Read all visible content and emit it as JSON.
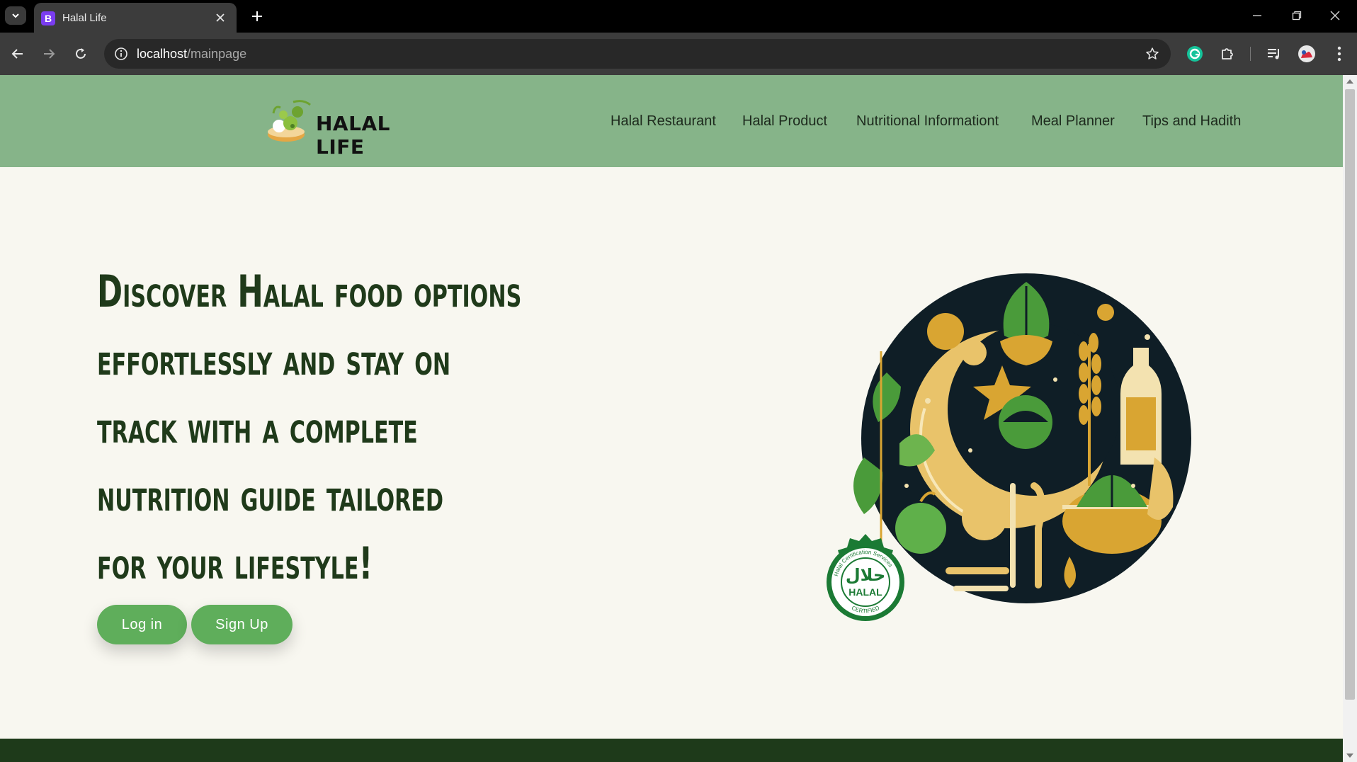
{
  "browser": {
    "tab": {
      "title": "Halal Life",
      "favicon_letter": "B"
    },
    "url": {
      "host": "localhost",
      "path": "/mainpage"
    },
    "icons": [
      "tab-list-icon",
      "close-icon",
      "plus-icon",
      "minimize-icon",
      "restore-icon",
      "close-window-icon",
      "back-icon",
      "forward-icon",
      "reload-icon",
      "info-icon",
      "star-icon",
      "grammarly-icon",
      "extensions-icon",
      "media-icon",
      "profile-icon",
      "kebab-menu-icon"
    ]
  },
  "site": {
    "logo_text": "HALAL LIFE",
    "nav": [
      "Halal Restaurant",
      "Halal Product",
      "Nutritional Informationt",
      "Meal Planner",
      "Tips and Hadith"
    ],
    "hero_lines": [
      "Discover Halal food options",
      "effortlessly and stay on",
      "track with a complete",
      "nutrition guide tailored",
      "for your lifestyle!"
    ],
    "buttons": {
      "login": "Log in",
      "signup": "Sign Up"
    },
    "badge": {
      "arabic": "حلال",
      "word": "HALAL",
      "ring_top": "Halal Certification Services",
      "ring_bottom": "CERTIFIED"
    }
  },
  "colors": {
    "header_green": "#86b489",
    "page_bg": "#f8f7f0",
    "hero_text": "#1f3a1a",
    "button_green": "#5fae5b",
    "footer_dark": "#1e3a1a",
    "art_navy": "#0f1e26",
    "art_gold": "#d9a532",
    "art_green": "#4a9b3a"
  }
}
